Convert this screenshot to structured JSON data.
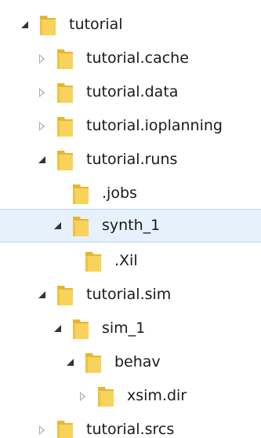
{
  "tree": {
    "items": [
      {
        "label": "tutorial",
        "state": "expanded",
        "selected": false
      },
      {
        "label": "tutorial.cache",
        "state": "collapsed",
        "selected": false
      },
      {
        "label": "tutorial.data",
        "state": "collapsed",
        "selected": false
      },
      {
        "label": "tutorial.ioplanning",
        "state": "collapsed",
        "selected": false
      },
      {
        "label": "tutorial.runs",
        "state": "expanded",
        "selected": false
      },
      {
        "label": ".jobs",
        "state": "none",
        "selected": false
      },
      {
        "label": "synth_1",
        "state": "expanded",
        "selected": true
      },
      {
        "label": ".Xil",
        "state": "none",
        "selected": false
      },
      {
        "label": "tutorial.sim",
        "state": "expanded",
        "selected": false
      },
      {
        "label": "sim_1",
        "state": "expanded",
        "selected": false
      },
      {
        "label": "behav",
        "state": "expanded",
        "selected": false
      },
      {
        "label": "xsim.dir",
        "state": "collapsed",
        "selected": false
      },
      {
        "label": "tutorial.srcs",
        "state": "collapsed",
        "selected": false
      }
    ]
  },
  "colors": {
    "selection_background": "#e6f1fc",
    "selection_border": "#bcd8f4",
    "folder_yellow": "#f5c945",
    "text": "#1a1a1a"
  }
}
